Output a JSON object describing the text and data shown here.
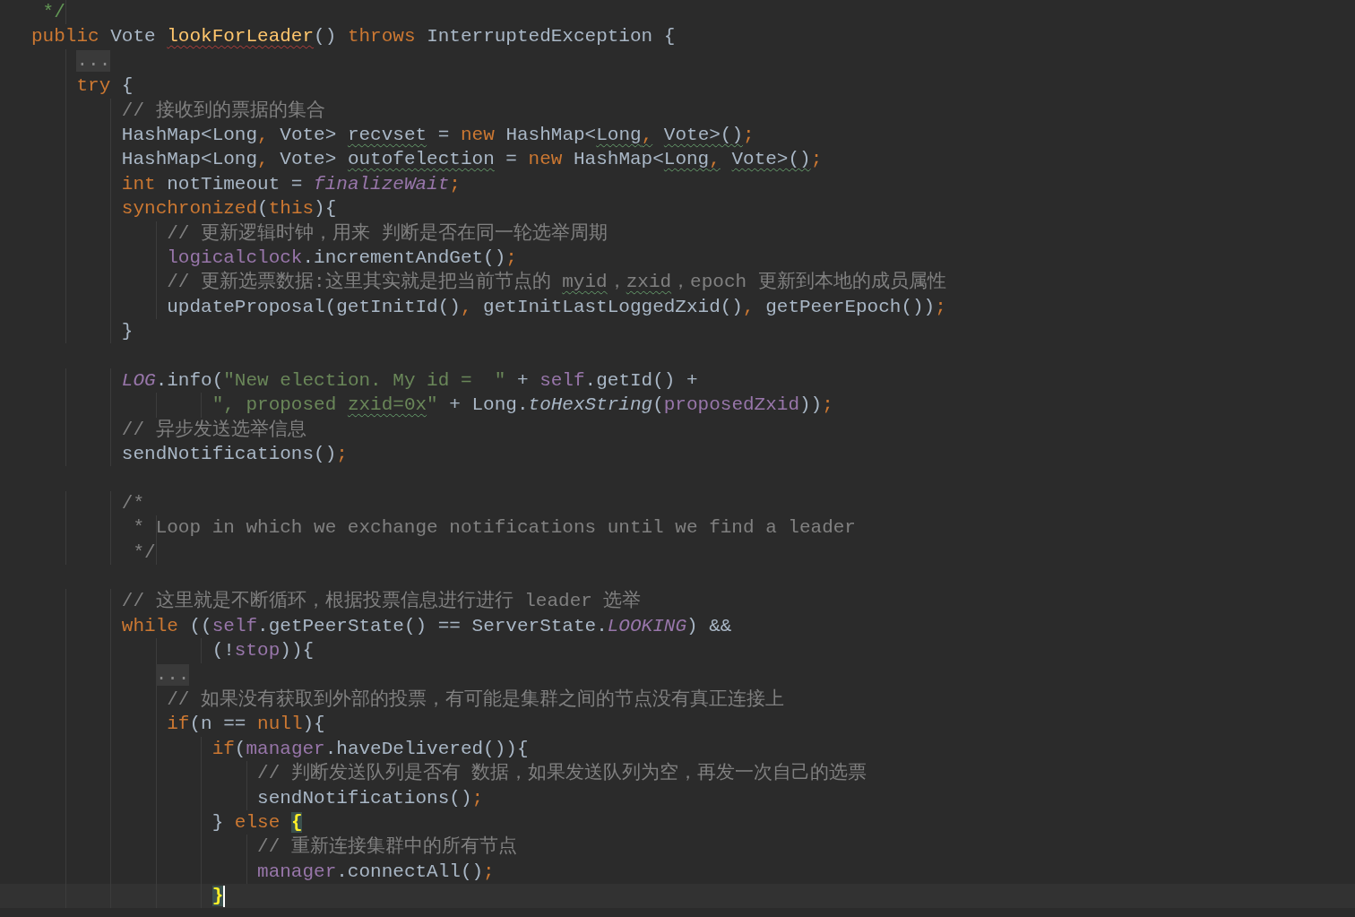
{
  "editor": {
    "lines": [
      {
        "kind": "code",
        "current": false,
        "tokens": [
          {
            "text": " */",
            "kind": "doc"
          }
        ]
      },
      {
        "kind": "code",
        "current": false,
        "tokens": [
          {
            "text": "public",
            "kind": "keyword"
          },
          {
            "text": " Vote ",
            "kind": "plain"
          },
          {
            "text": "lookForLeader",
            "kind": "method",
            "error": true
          },
          {
            "text": "() ",
            "kind": "plain"
          },
          {
            "text": "throws",
            "kind": "keyword"
          },
          {
            "text": " InterruptedException {",
            "kind": "plain"
          }
        ]
      },
      {
        "kind": "fold",
        "current": false,
        "tokens": [
          {
            "text": "    ...",
            "kind": "fold"
          }
        ]
      },
      {
        "kind": "code",
        "current": false,
        "tokens": [
          {
            "text": "    try",
            "kind": "keyword"
          },
          {
            "text": " {",
            "kind": "plain"
          }
        ]
      },
      {
        "kind": "code",
        "current": false,
        "tokens": [
          {
            "text": "        // 接收到的票据的集合",
            "kind": "comment"
          }
        ]
      },
      {
        "kind": "code",
        "current": false,
        "tokens": [
          {
            "text": "        HashMap<Long",
            "kind": "plain"
          },
          {
            "text": ",",
            "kind": "keyword"
          },
          {
            "text": " Vote> ",
            "kind": "plain"
          },
          {
            "text": "recvset",
            "kind": "plain",
            "typo": true
          },
          {
            "text": " = ",
            "kind": "plain"
          },
          {
            "text": "new",
            "kind": "keyword"
          },
          {
            "text": " HashMap<",
            "kind": "plain"
          },
          {
            "text": "Long",
            "kind": "plain",
            "typo": true
          },
          {
            "text": ",",
            "kind": "keyword",
            "typo": true
          },
          {
            "text": " Vote>()",
            "kind": "plain",
            "typo": true
          },
          {
            "text": ";",
            "kind": "keyword"
          }
        ]
      },
      {
        "kind": "code",
        "current": false,
        "tokens": [
          {
            "text": "        HashMap<Long",
            "kind": "plain"
          },
          {
            "text": ",",
            "kind": "keyword"
          },
          {
            "text": " Vote> ",
            "kind": "plain"
          },
          {
            "text": "outofelection",
            "kind": "plain",
            "typo": true
          },
          {
            "text": " = ",
            "kind": "plain"
          },
          {
            "text": "new",
            "kind": "keyword"
          },
          {
            "text": " HashMap<",
            "kind": "plain"
          },
          {
            "text": "Long",
            "kind": "plain",
            "typo": true
          },
          {
            "text": ",",
            "kind": "keyword",
            "typo": true
          },
          {
            "text": " Vote>()",
            "kind": "plain",
            "typo": true
          },
          {
            "text": ";",
            "kind": "keyword"
          }
        ]
      },
      {
        "kind": "code",
        "current": false,
        "tokens": [
          {
            "text": "        int",
            "kind": "keyword"
          },
          {
            "text": " notTimeout = ",
            "kind": "plain"
          },
          {
            "text": "finalizeWait",
            "kind": "static"
          },
          {
            "text": ";",
            "kind": "keyword"
          }
        ]
      },
      {
        "kind": "code",
        "current": false,
        "tokens": [
          {
            "text": "        synchronized",
            "kind": "keyword"
          },
          {
            "text": "(",
            "kind": "plain"
          },
          {
            "text": "this",
            "kind": "keyword"
          },
          {
            "text": "){",
            "kind": "plain"
          }
        ]
      },
      {
        "kind": "code",
        "current": false,
        "tokens": [
          {
            "text": "            // 更新逻辑时钟，用来 判断是否在同一轮选举周期",
            "kind": "comment"
          }
        ]
      },
      {
        "kind": "code",
        "current": false,
        "tokens": [
          {
            "text": "            logicalclock",
            "kind": "field"
          },
          {
            "text": ".incrementAndGet()",
            "kind": "plain"
          },
          {
            "text": ";",
            "kind": "keyword"
          }
        ]
      },
      {
        "kind": "code",
        "current": false,
        "tokens": [
          {
            "text": "            // 更新选票数据:这里其实就是把当前节点的 ",
            "kind": "comment"
          },
          {
            "text": "myid",
            "kind": "comment",
            "typo": true
          },
          {
            "text": "，",
            "kind": "comment"
          },
          {
            "text": "zxid",
            "kind": "comment",
            "typo": true
          },
          {
            "text": "，epoch 更新到本地的成员属性",
            "kind": "comment"
          }
        ]
      },
      {
        "kind": "code",
        "current": false,
        "tokens": [
          {
            "text": "            updateProposal(getInitId()",
            "kind": "plain"
          },
          {
            "text": ",",
            "kind": "keyword"
          },
          {
            "text": " getInitLastLoggedZxid()",
            "kind": "plain"
          },
          {
            "text": ",",
            "kind": "keyword"
          },
          {
            "text": " getPeerEpoch())",
            "kind": "plain"
          },
          {
            "text": ";",
            "kind": "keyword"
          }
        ]
      },
      {
        "kind": "code",
        "current": false,
        "tokens": [
          {
            "text": "        }",
            "kind": "plain"
          }
        ]
      },
      {
        "kind": "blank"
      },
      {
        "kind": "code",
        "current": false,
        "tokens": [
          {
            "text": "        LOG",
            "kind": "static"
          },
          {
            "text": ".info(",
            "kind": "plain"
          },
          {
            "text": "\"New election. My id =  \"",
            "kind": "string"
          },
          {
            "text": " + ",
            "kind": "plain"
          },
          {
            "text": "self",
            "kind": "field"
          },
          {
            "text": ".getId() +",
            "kind": "plain"
          }
        ]
      },
      {
        "kind": "code",
        "current": false,
        "tokens": [
          {
            "text": "                \", proposed ",
            "kind": "string"
          },
          {
            "text": "zxid=0x",
            "kind": "string",
            "typo": true
          },
          {
            "text": "\"",
            "kind": "string"
          },
          {
            "text": " + Long.",
            "kind": "plain"
          },
          {
            "text": "toHexString",
            "kind": "italic"
          },
          {
            "text": "(",
            "kind": "plain"
          },
          {
            "text": "proposedZxid",
            "kind": "field"
          },
          {
            "text": "))",
            "kind": "plain"
          },
          {
            "text": ";",
            "kind": "keyword"
          }
        ]
      },
      {
        "kind": "code",
        "current": false,
        "tokens": [
          {
            "text": "        // 异步发送选举信息",
            "kind": "comment"
          }
        ]
      },
      {
        "kind": "code",
        "current": false,
        "tokens": [
          {
            "text": "        sendNotifications()",
            "kind": "plain"
          },
          {
            "text": ";",
            "kind": "keyword"
          }
        ]
      },
      {
        "kind": "blank"
      },
      {
        "kind": "code",
        "current": false,
        "tokens": [
          {
            "text": "        /*",
            "kind": "comment"
          }
        ]
      },
      {
        "kind": "code",
        "current": false,
        "tokens": [
          {
            "text": "         * Loop in which we exchange notifications until we find a leader",
            "kind": "comment"
          }
        ]
      },
      {
        "kind": "code",
        "current": false,
        "tokens": [
          {
            "text": "         */",
            "kind": "comment"
          }
        ]
      },
      {
        "kind": "blank"
      },
      {
        "kind": "code",
        "current": false,
        "tokens": [
          {
            "text": "        // 这里就是不断循环，根据投票信息进行进行 leader 选举",
            "kind": "comment"
          }
        ]
      },
      {
        "kind": "code",
        "current": false,
        "tokens": [
          {
            "text": "        while",
            "kind": "keyword"
          },
          {
            "text": " ((",
            "kind": "plain"
          },
          {
            "text": "self",
            "kind": "field"
          },
          {
            "text": ".getPeerState() == ServerState.",
            "kind": "plain"
          },
          {
            "text": "LOOKING",
            "kind": "static"
          },
          {
            "text": ") &&",
            "kind": "plain"
          }
        ]
      },
      {
        "kind": "code",
        "current": false,
        "tokens": [
          {
            "text": "                (!",
            "kind": "plain"
          },
          {
            "text": "stop",
            "kind": "field"
          },
          {
            "text": ")){",
            "kind": "plain"
          }
        ]
      },
      {
        "kind": "fold",
        "current": false,
        "tokens": [
          {
            "text": "           ...",
            "kind": "fold"
          }
        ]
      },
      {
        "kind": "code",
        "current": false,
        "tokens": [
          {
            "text": "            // 如果没有获取到外部的投票，有可能是集群之间的节点没有真正连接上",
            "kind": "comment"
          }
        ]
      },
      {
        "kind": "code",
        "current": false,
        "tokens": [
          {
            "text": "            if",
            "kind": "keyword"
          },
          {
            "text": "(n == ",
            "kind": "plain"
          },
          {
            "text": "null",
            "kind": "keyword"
          },
          {
            "text": "){",
            "kind": "plain"
          }
        ]
      },
      {
        "kind": "code",
        "current": false,
        "tokens": [
          {
            "text": "                if",
            "kind": "keyword"
          },
          {
            "text": "(",
            "kind": "plain"
          },
          {
            "text": "manager",
            "kind": "field"
          },
          {
            "text": ".haveDelivered()){",
            "kind": "plain"
          }
        ]
      },
      {
        "kind": "code",
        "current": false,
        "tokens": [
          {
            "text": "                    // 判断发送队列是否有 数据，如果发送队列为空，再发一次自己的选票",
            "kind": "comment"
          }
        ]
      },
      {
        "kind": "code",
        "current": false,
        "tokens": [
          {
            "text": "                    sendNotifications()",
            "kind": "plain"
          },
          {
            "text": ";",
            "kind": "keyword"
          }
        ]
      },
      {
        "kind": "code",
        "current": false,
        "tokens": [
          {
            "text": "                } ",
            "kind": "plain"
          },
          {
            "text": "else ",
            "kind": "keyword"
          },
          {
            "text": "{",
            "kind": "brace"
          }
        ]
      },
      {
        "kind": "code",
        "current": false,
        "tokens": [
          {
            "text": "                    // 重新连接集群中的所有节点",
            "kind": "comment"
          }
        ]
      },
      {
        "kind": "code",
        "current": false,
        "tokens": [
          {
            "text": "                    manager",
            "kind": "field"
          },
          {
            "text": ".connectAll()",
            "kind": "plain"
          },
          {
            "text": ";",
            "kind": "keyword"
          }
        ]
      },
      {
        "kind": "code",
        "current": true,
        "tokens": [
          {
            "text": "                }",
            "kind": "brace"
          }
        ]
      }
    ]
  }
}
